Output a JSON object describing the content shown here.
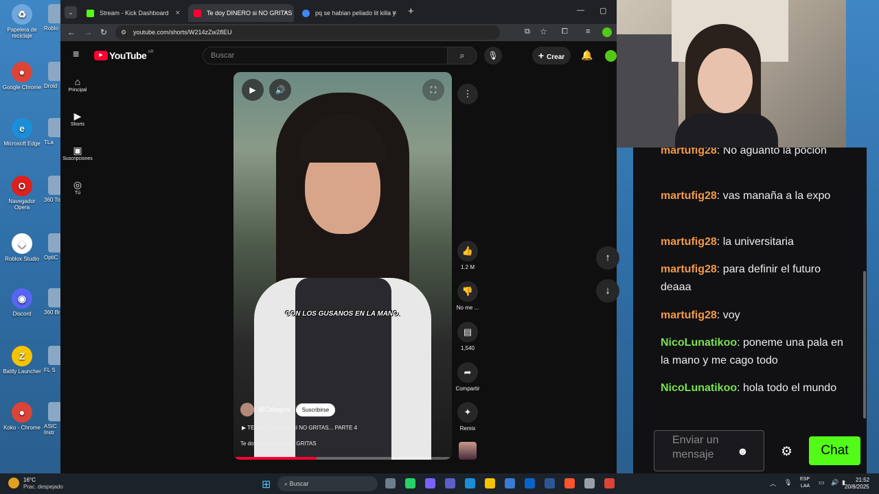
{
  "desktop": {
    "icons": [
      {
        "label": "Papelera de reciclaje",
        "color": "#6fa8dc",
        "glyph": "♻"
      },
      {
        "label": "Google Chrome",
        "color": "#db4437",
        "glyph": "●"
      },
      {
        "label": "Microsoft Edge",
        "color": "#1a8fd8",
        "glyph": "e"
      },
      {
        "label": "Navegador Opera",
        "color": "#e0201c",
        "glyph": "O"
      },
      {
        "label": "Roblox Studio",
        "color": "#ffffff",
        "glyph": "◆"
      },
      {
        "label": "Discord",
        "color": "#5865f2",
        "glyph": "◉"
      },
      {
        "label": "Battly Launcher",
        "color": "#f5c400",
        "glyph": "Z"
      },
      {
        "label": "Koko - Chrome",
        "color": "#db4437",
        "glyph": "●"
      }
    ],
    "icons2": [
      "Roblo",
      "Droid",
      "TLa",
      "360 To",
      "OptiC",
      "360 Br",
      "FL S",
      "ASIC Instr"
    ]
  },
  "browser": {
    "tabs": [
      {
        "title": "Stream - Kick Dashboard",
        "color": "#53fc18"
      },
      {
        "title": "Te doy DINERO si NO GRITAS",
        "color": "#ff0033"
      },
      {
        "title": "pq se habian peliado lit killa y c",
        "color": "#4285f4"
      }
    ],
    "new_tab": "+",
    "url": "youtube.com/shorts/W214zZw28EU"
  },
  "youtube": {
    "logo_text": "YouTube",
    "region": "AR",
    "search_placeholder": "Buscar",
    "create_label": "Crear",
    "sidebar": [
      {
        "label": "Principal",
        "glyph": "⌂"
      },
      {
        "label": "Shorts",
        "glyph": "▶"
      },
      {
        "label": "Suscripciones",
        "glyph": "▣"
      },
      {
        "label": "Tú",
        "glyph": "◎"
      }
    ],
    "video": {
      "caption": "CON LOS GUSANOS EN LA MANO.",
      "channel": "@Cellegrini",
      "subscribe": "Suscribirse",
      "playlist": "TE DOY DINERO SI NO GRITAS... PARTE 4",
      "title": "Te doy DINERO si NO GRITAS",
      "progress": 0.38
    },
    "actions": [
      {
        "name": "like",
        "glyph": "👍",
        "label": "1.2 M"
      },
      {
        "name": "dislike",
        "glyph": "👎",
        "label": "No me ..."
      },
      {
        "name": "comments",
        "glyph": "▤",
        "label": "1,540"
      },
      {
        "name": "share",
        "glyph": "➦",
        "label": "Compartir"
      },
      {
        "name": "remix",
        "glyph": "✦",
        "label": "Remix"
      }
    ]
  },
  "chat": {
    "messages": [
      {
        "user": "martufig28",
        "text": "No aguanto la poción",
        "color": "#f49a46"
      },
      {
        "user": "martufig28",
        "text": "vas manaña a la expo",
        "color": "#f49a46"
      },
      {
        "user": "martufig28",
        "text": "la universitaria",
        "color": "#f49a46"
      },
      {
        "user": "martufig28",
        "text": "para definir el futuro deaaa",
        "color": "#f49a46"
      },
      {
        "user": "martufig28",
        "text": "voy",
        "color": "#f49a46"
      },
      {
        "user": "NicoLunatikoo",
        "text": "poneme una pala en la mano y me cago todo",
        "color": "#78e24e"
      },
      {
        "user": "NicoLunatikoo",
        "text": "hola todo el mundo",
        "color": "#78e24e"
      }
    ],
    "input_placeholder": "Enviar un mensaje",
    "chat_button": "Chat"
  },
  "taskbar": {
    "weather_temp": "16°C",
    "weather_desc": "Prac. despejado",
    "search": "Buscar",
    "lang1": "ESP",
    "lang2": "LAA",
    "time": "21:52",
    "date": "20/8/2025"
  }
}
